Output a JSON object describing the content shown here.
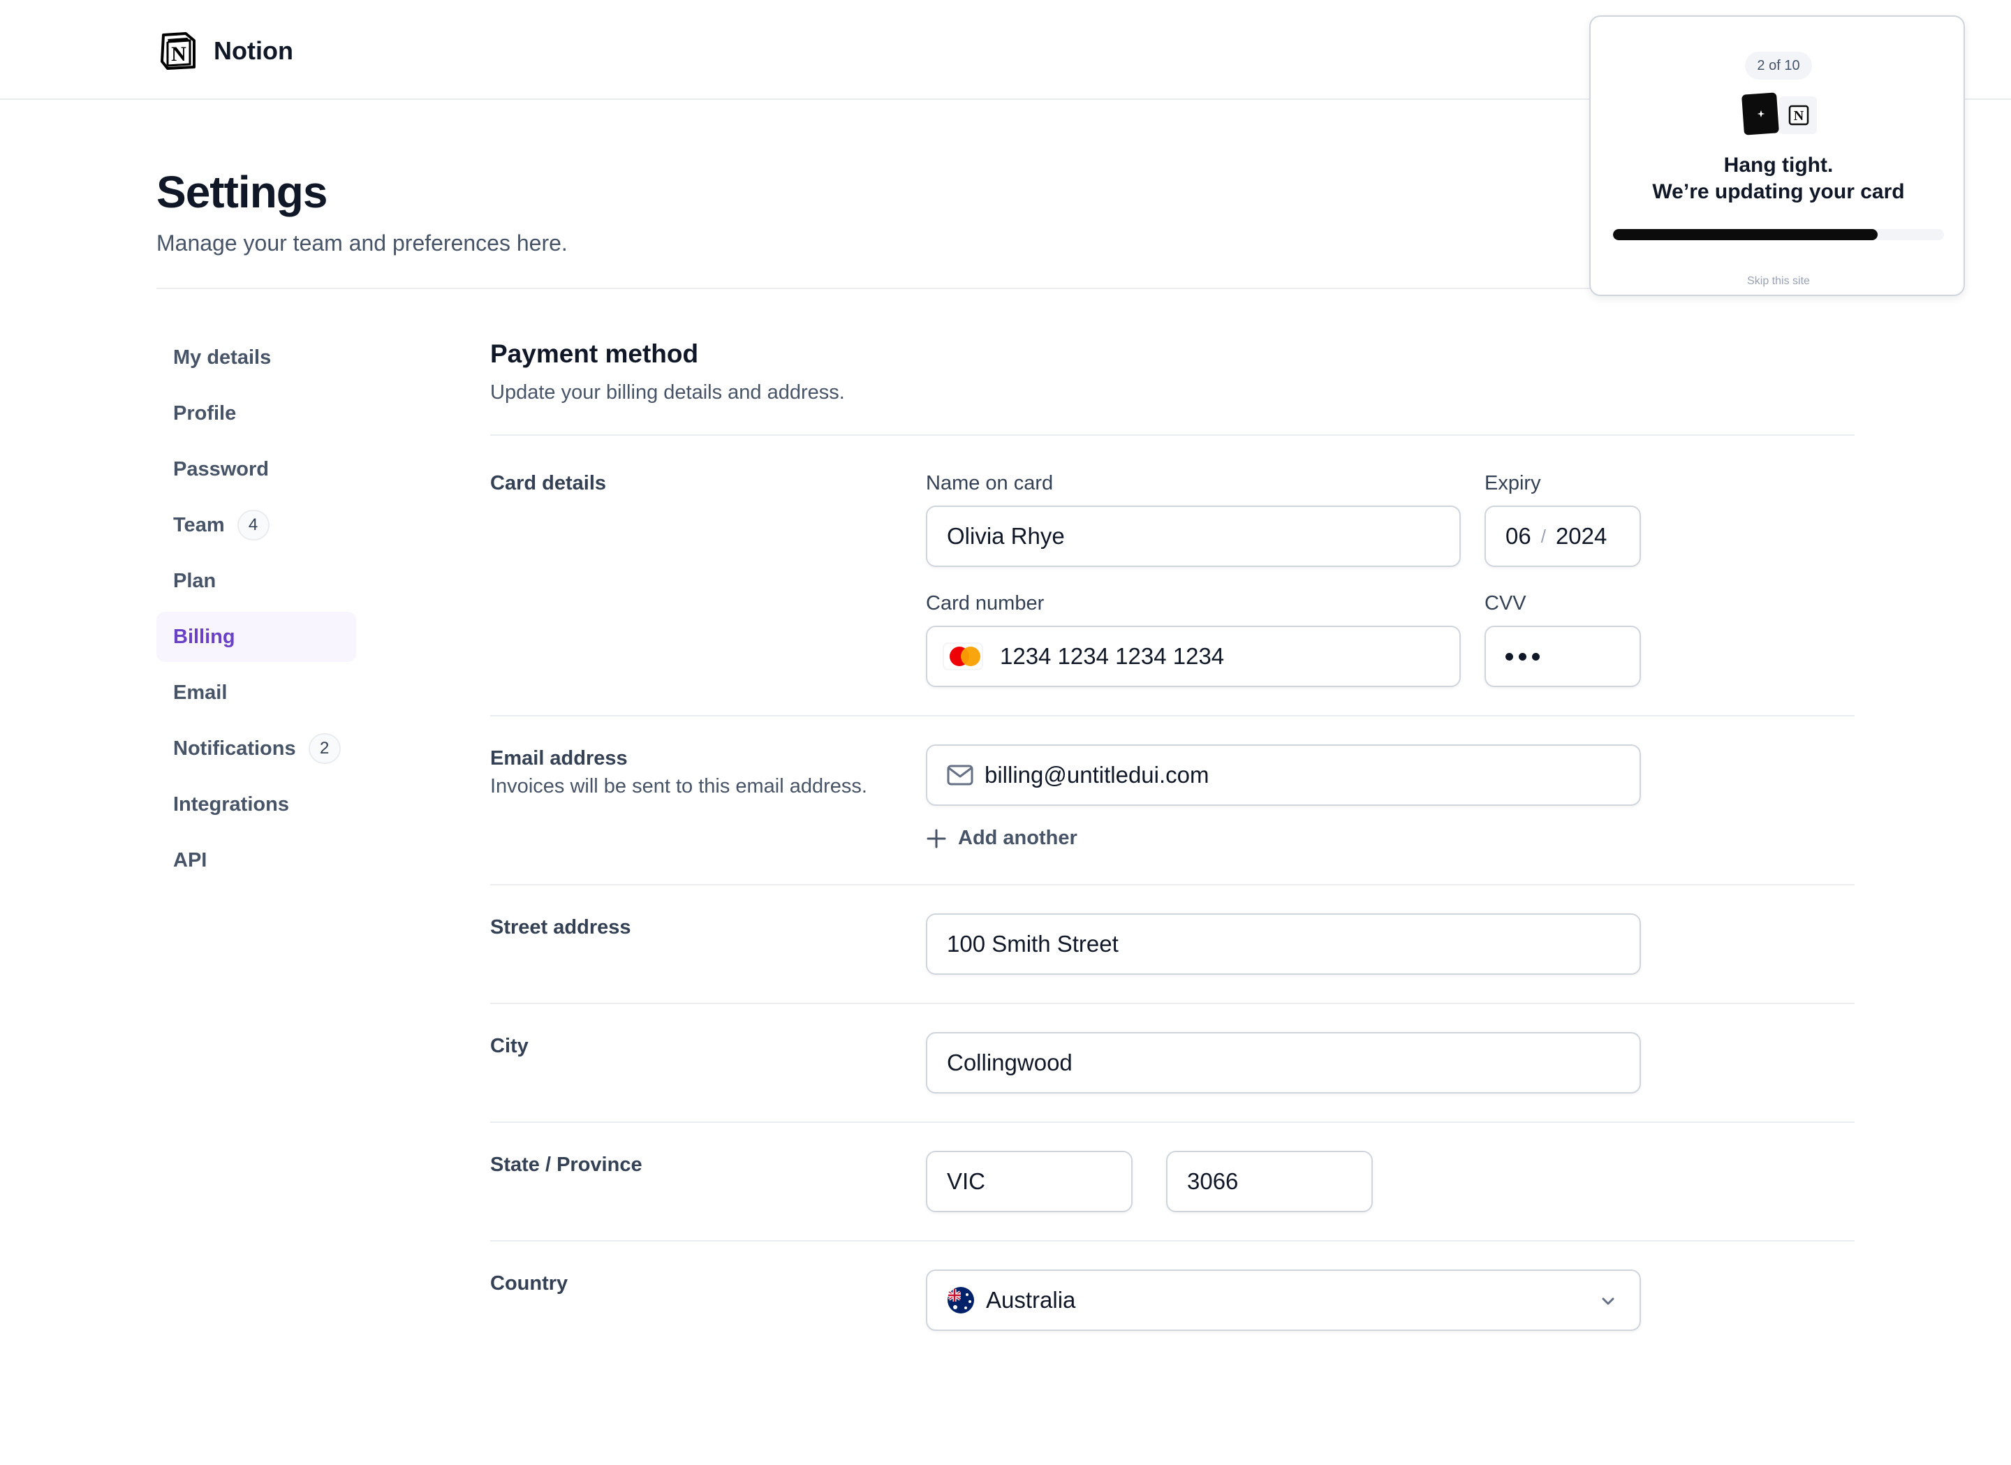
{
  "app": {
    "name": "Notion"
  },
  "header": {
    "title": "Settings",
    "subtitle": "Manage your team and preferences here."
  },
  "sidebar": {
    "items": [
      {
        "label": "My details"
      },
      {
        "label": "Profile"
      },
      {
        "label": "Password"
      },
      {
        "label": "Team",
        "badge": "4"
      },
      {
        "label": "Plan"
      },
      {
        "label": "Billing",
        "active": true
      },
      {
        "label": "Email"
      },
      {
        "label": "Notifications",
        "badge": "2"
      },
      {
        "label": "Integrations"
      },
      {
        "label": "API"
      }
    ]
  },
  "main": {
    "section_title": "Payment method",
    "section_subtitle": "Update your billing details and address.",
    "card_details": {
      "label": "Card details",
      "name_label": "Name on card",
      "name_value": "Olivia Rhye",
      "expiry_label": "Expiry",
      "expiry_month": "06",
      "expiry_separator": "/",
      "expiry_year": "2024",
      "number_label": "Card number",
      "number_value": "1234 1234 1234 1234",
      "cvv_label": "CVV"
    },
    "email": {
      "label": "Email address",
      "hint": "Invoices will be sent to this email address.",
      "value": "billing@untitledui.com",
      "add_another": "Add another"
    },
    "street": {
      "label": "Street address",
      "value": "100 Smith Street"
    },
    "city": {
      "label": "City",
      "value": "Collingwood"
    },
    "state": {
      "label": "State / Province",
      "state_value": "VIC",
      "postcode_value": "3066"
    },
    "country": {
      "label": "Country",
      "value": "Australia"
    }
  },
  "overlay": {
    "step": "2 of 10",
    "title_line1": "Hang tight.",
    "title_line2": "We’re updating your card",
    "progress_percent": 80,
    "skip_label": "Skip this site"
  },
  "icons": {
    "brand": "notion-logo-icon",
    "card": "mastercard-icon",
    "email": "mail-icon",
    "add": "plus-icon",
    "flag": "australia-flag-icon",
    "chevron": "chevron-down-icon"
  },
  "colors": {
    "accent": "#6941c6",
    "accent_bg": "#f9f5ff",
    "text_primary": "#101828",
    "text_secondary": "#475467",
    "border": "#d0d5dd",
    "divider": "#eaecf0"
  }
}
